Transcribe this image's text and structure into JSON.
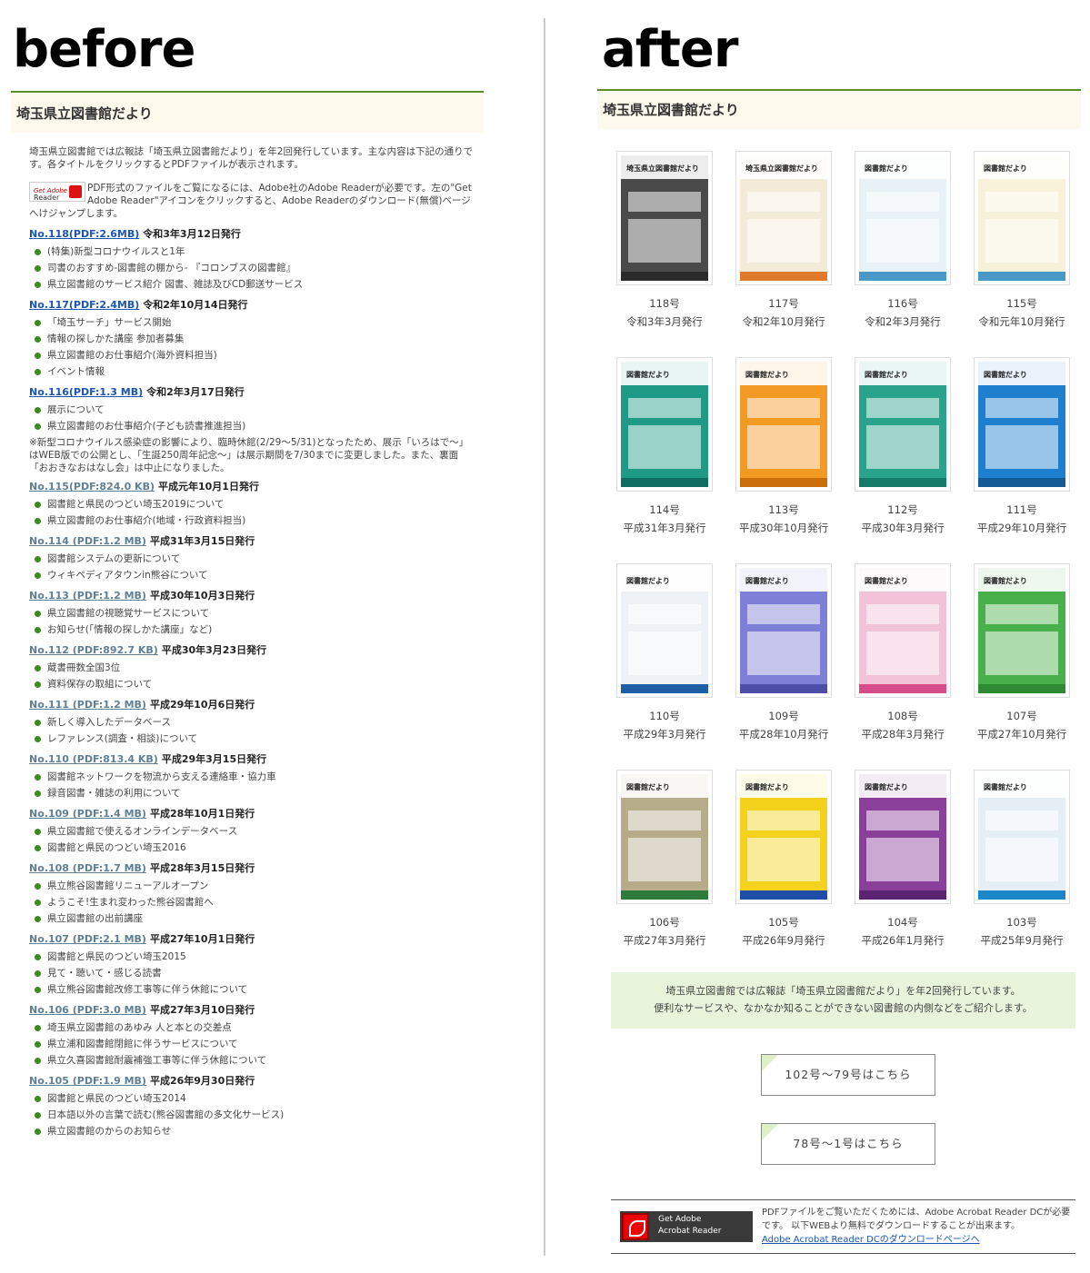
{
  "labels": {
    "before": "before",
    "after": "after"
  },
  "left": {
    "title": "埼玉県立図書館だより",
    "intro": "埼玉県立図書館では広報誌「埼玉県立図書館だより」を年2回発行しています。主な内容は下記の通りです。各タイトルをクリックするとPDFファイルが表示されます。",
    "reader_badge": {
      "line1": "Get Adobe",
      "line2": "Reader"
    },
    "reader_text": "PDF形式のファイルをご覧になるには、Adobe社のAdobe Readerが必要です。左の\"Get Adobe Reader\"アイコンをクリックすると、Adobe Readerのダウンロード(無償)ページへけジャンプします。",
    "issues": [
      {
        "link": "No.118(PDF:2.6MB)",
        "date": "令和3年3月12日発行",
        "style": "blue",
        "items": [
          "(特集)新型コロナウイルスと1年",
          "司書のおすすめ-図書館の棚から- 『コロンブスの図書館』",
          "県立図書館のサービス紹介 図書、雑誌及びCD郵送サービス"
        ]
      },
      {
        "link": "No.117(PDF:2.4MB)",
        "date": "令和2年10月14日発行",
        "style": "blue",
        "items": [
          "「埼玉サーチ」サービス開始",
          "情報の探しかた講座 参加者募集",
          "県立図書館のお仕事紹介(海外資料担当)",
          "イベント情報"
        ]
      },
      {
        "link": "No.116(PDF:1.3 MB)",
        "date": "令和2年3月17日発行",
        "style": "blue",
        "items": [
          "展示について",
          "県立図書館のお仕事紹介(子ども読書推進担当)"
        ],
        "note": "※新型コロナウイルス感染症の影響により、臨時休館(2/29～5/31)となったため、展示「いろはで～」はWEB版での公開とし、「生誕250周年記念～」は展示期間を7/30までに変更しました。また、裏面「おおきなおはなし会」は中止になりました。"
      },
      {
        "link": "No.115(PDF:824.0 KB)",
        "date": "平成元年10月1日発行",
        "style": "gray",
        "items": [
          "図書館と県民のつどい埼玉2019について",
          "県立図書館のお仕事紹介(地域・行政資料担当)"
        ]
      },
      {
        "link": "No.114 (PDF:1.2 MB)",
        "date": "平成31年3月15日発行",
        "style": "gray",
        "items": [
          "図書館システムの更新について",
          "ウィキペディアタウンin熊谷について"
        ]
      },
      {
        "link": "No.113 (PDF:1.2 MB)",
        "date": "平成30年10月3日発行",
        "style": "gray",
        "items": [
          "県立図書館の視聴覚サービスについて",
          "お知らせ(「情報の探しかた講座」など)"
        ]
      },
      {
        "link": "No.112 (PDF:892.7 KB)",
        "date": "平成30年3月23日発行",
        "style": "gray",
        "items": [
          "蔵書冊数全国3位",
          "資料保存の取組について"
        ]
      },
      {
        "link": "No.111 (PDF:1.2 MB)",
        "date": "平成29年10月6日発行",
        "style": "gray",
        "items": [
          "新しく導入したデータベース",
          "レファレンス(調査・相談)について"
        ]
      },
      {
        "link": "No.110 (PDF:813.4 KB)",
        "date": "平成29年3月15日発行",
        "style": "gray",
        "items": [
          "図書館ネットワークを物流から支える連絡車・協力車",
          "録音図書・雑誌の利用について"
        ]
      },
      {
        "link": "No.109 (PDF:1.4 MB)",
        "date": "平成28年10月1日発行",
        "style": "gray",
        "items": [
          "県立図書館で使えるオンラインデータベース",
          "図書館と県民のつどい埼玉2016"
        ]
      },
      {
        "link": "No.108 (PDF:1.7 MB)",
        "date": "平成28年3月15日発行",
        "style": "gray",
        "items": [
          "県立熊谷図書館リニューアルオープン",
          "ようこそ!生まれ変わった熊谷図書館へ",
          "県立図書館の出前講座"
        ]
      },
      {
        "link": "No.107 (PDF:2.1 MB)",
        "date": "平成27年10月1日発行",
        "style": "gray",
        "items": [
          "図書館と県民のつどい埼玉2015",
          "見て・聴いて・感じる読書",
          "県立熊谷図書館改修工事等に伴う休館について"
        ]
      },
      {
        "link": "No.106 (PDF:3.0 MB)",
        "date": "平成27年3月10日発行",
        "style": "gray",
        "items": [
          "埼玉県立図書館のあゆみ 人と本との交差点",
          "県立浦和図書館閉館に伴うサービスについて",
          "県立久喜図書館耐震補強工事等に伴う休館について"
        ]
      },
      {
        "link": "No.105 (PDF:1.9 MB)",
        "date": "平成26年9月30日発行",
        "style": "gray",
        "items": [
          "図書館と県民のつどい埼玉2014",
          "日本語以外の言葉で読む(熊谷図書館の多文化サービス)",
          "県立図書館のからのお知らせ"
        ]
      }
    ]
  },
  "right": {
    "title": "埼玉県立図書館だより",
    "covers": [
      {
        "num": "118号",
        "date": "令和3年3月発行",
        "bg": "#4a4a4a",
        "band": "埼玉県立図書館だより",
        "stripe": "#2b2b2b"
      },
      {
        "num": "117号",
        "date": "令和2年10月発行",
        "bg": "#f3ead7",
        "band": "埼玉県立図書館だより",
        "stripe": "#e07a2b"
      },
      {
        "num": "116号",
        "date": "令和2年3月発行",
        "bg": "#e8f2f6",
        "band": "図書館だより",
        "stripe": "#4a98c8"
      },
      {
        "num": "115号",
        "date": "令和元年10月発行",
        "bg": "#f6f1d8",
        "band": "図書館だより",
        "stripe": "#4a98c8"
      },
      {
        "num": "114号",
        "date": "平成31年3月発行",
        "bg": "#1f9a87",
        "band": "図書館だより",
        "stripe": "#0f6e61"
      },
      {
        "num": "113号",
        "date": "平成30年10月発行",
        "bg": "#f39a25",
        "band": "図書館だより",
        "stripe": "#c96e0a"
      },
      {
        "num": "112号",
        "date": "平成30年3月発行",
        "bg": "#2aa38c",
        "band": "図書館だより",
        "stripe": "#167a68"
      },
      {
        "num": "111号",
        "date": "平成29年10月発行",
        "bg": "#1e7fcf",
        "band": "図書館だより",
        "stripe": "#145a96"
      },
      {
        "num": "110号",
        "date": "平成29年3月発行",
        "bg": "#eef2f6",
        "band": "図書館だより",
        "stripe": "#1f5fa8"
      },
      {
        "num": "109号",
        "date": "平成28年10月発行",
        "bg": "#7e7fd6",
        "band": "図書館だより",
        "stripe": "#4c4ea8"
      },
      {
        "num": "108号",
        "date": "平成28年3月発行",
        "bg": "#f2c3d8",
        "band": "図書館だより",
        "stripe": "#d64b8a"
      },
      {
        "num": "107号",
        "date": "平成27年10月発行",
        "bg": "#47b04b",
        "band": "図書館だより",
        "stripe": "#2e8a33"
      },
      {
        "num": "106号",
        "date": "平成27年3月発行",
        "bg": "#b7ac8a",
        "band": "図書館だより",
        "stripe": "#2e7a3a"
      },
      {
        "num": "105号",
        "date": "平成26年9月発行",
        "bg": "#f4d21c",
        "band": "図書館だより",
        "stripe": "#1f4ea8"
      },
      {
        "num": "104号",
        "date": "平成26年1月発行",
        "bg": "#8a3f9a",
        "band": "図書館だより",
        "stripe": "#5c2470"
      },
      {
        "num": "103号",
        "date": "平成25年9月発行",
        "bg": "#e6eef5",
        "band": "図書館だより",
        "stripe": "#1a88c8"
      }
    ],
    "notice_line1": "埼玉県立図書館では広報誌「埼玉県立図書館だより」を年2回発行しています。",
    "notice_line2": "便利なサービスや、なかなか知ることができない図書館の内側などをご紹介します。",
    "button_102": "102号～79号はこちら",
    "button_78": "78号～1号はこちら",
    "acro_badge": {
      "line1": "Get Adobe",
      "line2": "Acrobat Reader"
    },
    "acro_text": "PDFファイルをご覧いただくためには、Adobe Acrobat Reader DCが必要です。 以下WEBより無料でダウンロードすることが出来ます。",
    "acro_link": "Adobe Acrobat Reader DCのダウンロードページへ"
  }
}
